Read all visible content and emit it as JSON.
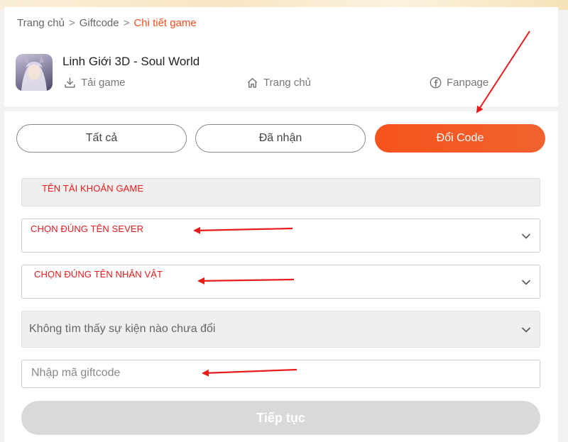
{
  "breadcrumb": {
    "home": "Trang chủ",
    "giftcode": "Giftcode",
    "current": "Chi tiết game",
    "separator": ">"
  },
  "game": {
    "title": "Linh Giới 3D - Soul World",
    "links": {
      "download": "Tải game",
      "home": "Trang chủ",
      "fanpage": "Fanpage"
    }
  },
  "tabs": {
    "all": "Tất cả",
    "received": "Đã nhận",
    "redeem": "Đổi Code"
  },
  "form": {
    "account_note": "TÊN TÀI KHOẢN GAME",
    "server_note": "CHỌN ĐÚNG TÊN SEVER",
    "character_note": "CHỌN ĐÚNG TÊN NHÂN VẬT",
    "event_select": "Không tìm thấy sự kiện nào chưa đổi",
    "giftcode_placeholder": "Nhập mã giftcode",
    "submit": "Tiếp tục"
  },
  "colors": {
    "accent": "#f4511e",
    "annotation": "#e81b1b",
    "disabled": "#d9d9d9"
  }
}
